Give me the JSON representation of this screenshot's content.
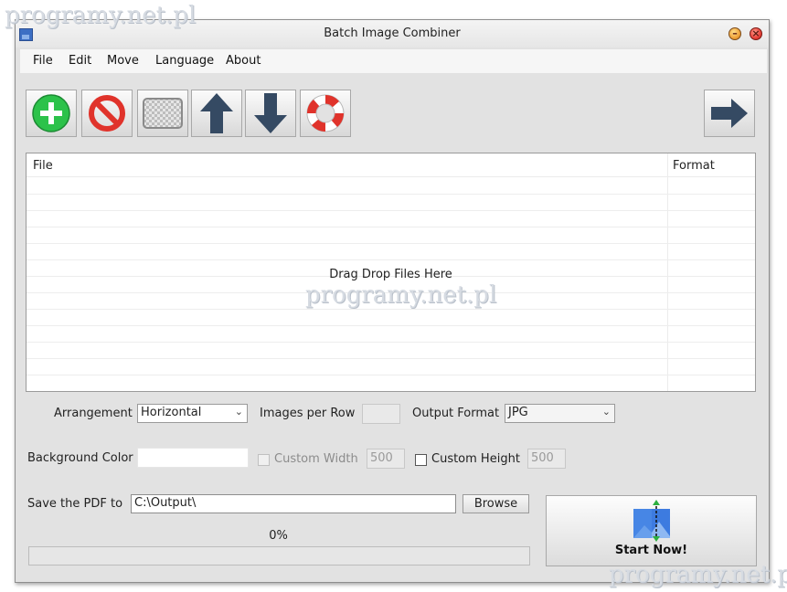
{
  "watermark": "programy.net.pl",
  "window": {
    "title": "Batch Image Combiner"
  },
  "menu": [
    "File",
    "Edit",
    "Move",
    "Language",
    "About"
  ],
  "toolbar": {
    "icons": [
      "add-icon",
      "remove-icon",
      "clear-icon",
      "move-up-icon",
      "move-down-icon",
      "help-icon",
      "next-arrow-icon"
    ]
  },
  "filelist": {
    "columns": [
      "File",
      "Format"
    ],
    "empty_text": "Drag  Drop Files Here"
  },
  "options": {
    "arrangement_label": "Arrangement",
    "arrangement_value": "Horizontal",
    "images_per_row_label": "Images per Row",
    "images_per_row_value": "",
    "output_format_label": "Output Format",
    "output_format_value": "JPG",
    "background_color_label": "Background Color",
    "background_color_value": "",
    "custom_width_label": "Custom Width",
    "custom_width_value": "500",
    "custom_width_checked": false,
    "custom_height_label": "Custom Height",
    "custom_height_value": "500",
    "custom_height_checked": false
  },
  "output": {
    "save_label": "Save the PDF to",
    "save_path": "C:\\Output\\",
    "browse_label": "Browse"
  },
  "progress": {
    "text": "0%",
    "value": 0
  },
  "start": {
    "label": "Start Now!"
  },
  "colors": {
    "add": "#2cc24a",
    "remove": "#e0332b",
    "arrow": "#354a63",
    "accent": "#3d6fc4"
  }
}
